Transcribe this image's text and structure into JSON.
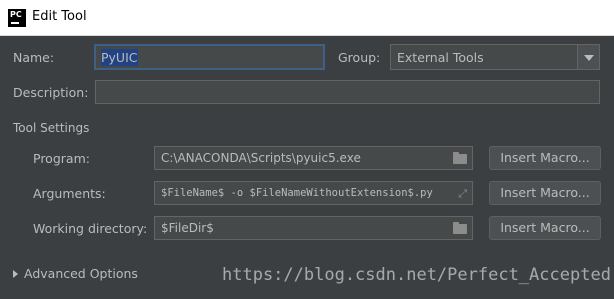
{
  "window": {
    "title": "Edit Tool",
    "app_icon_text": "PC"
  },
  "form": {
    "name_label": "Name:",
    "name_value": "PyUIC",
    "group_label": "Group:",
    "group_value": "External Tools",
    "description_label": "Description:",
    "description_value": ""
  },
  "tool_settings": {
    "section_label": "Tool Settings",
    "program_label": "Program:",
    "program_value": "C:\\ANACONDA\\Scripts\\pyuic5.exe",
    "arguments_label": "Arguments:",
    "arguments_value": "$FileName$ -o $FileNameWithoutExtension$.py",
    "working_dir_label": "Working directory:",
    "working_dir_value": "$FileDir$",
    "insert_macro_label": "Insert Macro..."
  },
  "advanced": {
    "label": "Advanced Options"
  },
  "watermark": "https://blog.csdn.net/Perfect_Accepted",
  "icons": {
    "program_field": "folder-icon",
    "arguments_field": "expand-icon",
    "working_dir_field": "folder-icon",
    "advanced_toggle": "triangle-right-icon"
  },
  "colors": {
    "dialog_bg": "#3c3f41",
    "field_bg": "#45494a",
    "focus_border": "#3d6185",
    "selection": "#214283",
    "text": "#bbbbbb"
  }
}
